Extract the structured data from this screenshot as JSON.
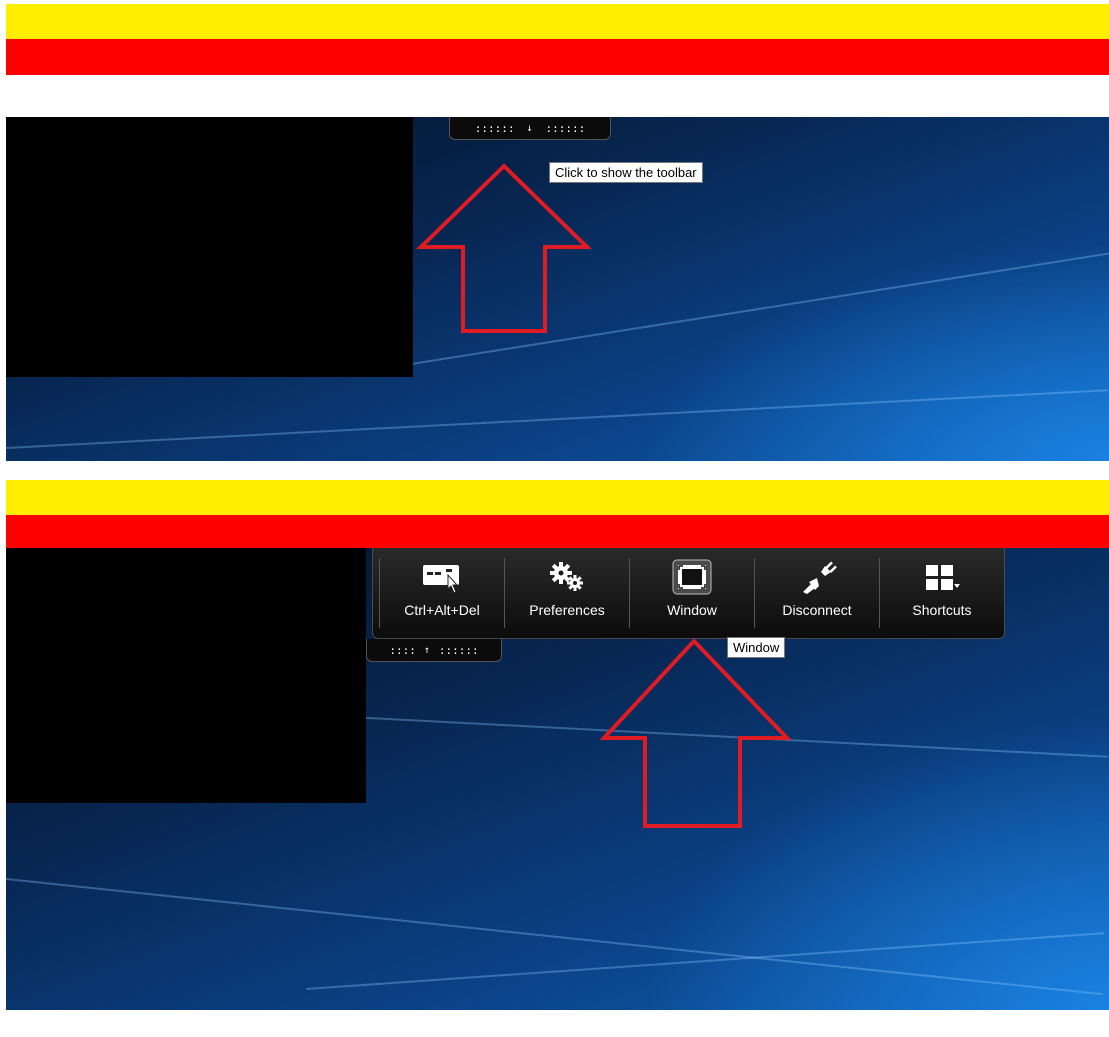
{
  "top_panel": {
    "handle": {
      "dots_left": "::::::",
      "arrow": "↓",
      "dots_right": "::::::"
    },
    "tooltip": "Click to show the toolbar"
  },
  "bottom_panel": {
    "toolbar": {
      "buttons": [
        {
          "label": "Ctrl+Alt+Del",
          "icon": "ctrl-alt-del-icon"
        },
        {
          "label": "Preferences",
          "icon": "gears-icon"
        },
        {
          "label": "Window",
          "icon": "window-icon"
        },
        {
          "label": "Disconnect",
          "icon": "disconnect-plug-icon"
        },
        {
          "label": "Shortcuts",
          "icon": "shortcuts-grid-icon"
        }
      ]
    },
    "handle": {
      "dots_left": "::::",
      "arrow": "↑",
      "dots_right": "::::::"
    },
    "tooltip": "Window"
  },
  "colors": {
    "highlight_yellow": "#ffee00",
    "highlight_red": "#ff0000",
    "arrow_red": "#e11b22"
  }
}
